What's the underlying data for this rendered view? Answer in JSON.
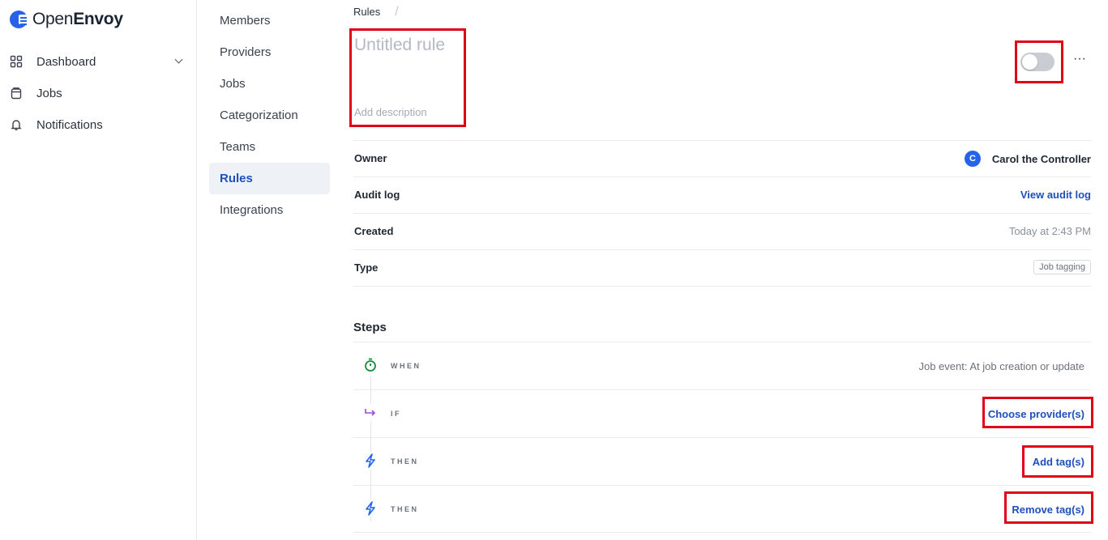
{
  "brand": {
    "name_prefix": "Open",
    "name_suffix": "Envoy"
  },
  "sidebar": {
    "items": [
      {
        "label": "Dashboard",
        "icon": "grid-icon"
      },
      {
        "label": "Jobs",
        "icon": "clipboard-icon"
      },
      {
        "label": "Notifications",
        "icon": "bell-icon"
      }
    ]
  },
  "settings_nav": {
    "items": [
      {
        "label": "Members"
      },
      {
        "label": "Providers"
      },
      {
        "label": "Jobs"
      },
      {
        "label": "Categorization"
      },
      {
        "label": "Teams"
      },
      {
        "label": "Rules",
        "active": true
      },
      {
        "label": "Integrations"
      }
    ]
  },
  "breadcrumb": {
    "root": "Rules",
    "separator": "/"
  },
  "rule": {
    "title_placeholder": "Untitled rule",
    "description_placeholder": "Add description",
    "enabled": false,
    "more_label": "···"
  },
  "properties": {
    "owner": {
      "label": "Owner",
      "avatar_initial": "C",
      "name": "Carol the Controller"
    },
    "audit_log": {
      "label": "Audit log",
      "link": "View audit log"
    },
    "created": {
      "label": "Created",
      "value": "Today at 2:43 PM"
    },
    "type": {
      "label": "Type",
      "value": "Job tagging"
    }
  },
  "steps": {
    "title": "Steps",
    "items": [
      {
        "keyword": "WHEN",
        "icon": "stopwatch-icon",
        "value": "Job event: At job creation or update"
      },
      {
        "keyword": "IF",
        "icon": "arrow-turn-icon",
        "value": "Choose provider(s)"
      },
      {
        "keyword": "THEN",
        "icon": "lightning-icon",
        "value": "Add tag(s)"
      },
      {
        "keyword": "THEN",
        "icon": "lightning-icon",
        "value": "Remove tag(s)"
      }
    ]
  },
  "colors": {
    "accent": "#1f4fbd",
    "brand": "#2563eb",
    "highlight": "#e0001a"
  }
}
